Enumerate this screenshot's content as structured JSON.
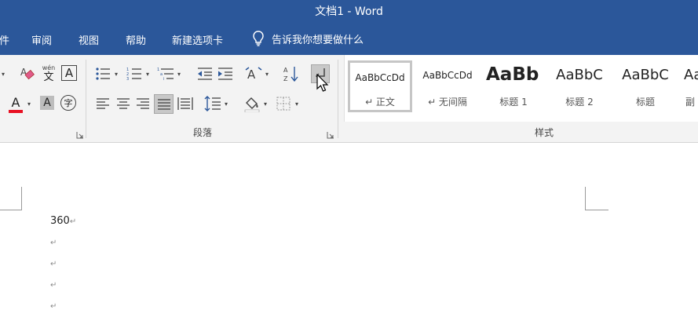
{
  "window": {
    "title": "文档1  -  Word"
  },
  "tabs": [
    "件",
    "审阅",
    "视图",
    "帮助",
    "新建选项卡"
  ],
  "tell_me": "告诉我你想要做什么",
  "ribbon": {
    "paragraph_group": "段落",
    "styles_group": "样式",
    "phonetic_glyph_top": "wén",
    "phonetic_glyph_main": "文",
    "boxed_char": "A",
    "shaded_char": "A",
    "font_color_char": "A",
    "enclosed_char": "字",
    "styles": [
      {
        "sample": "AaBbCcDd",
        "name": "↵ 正文",
        "selected": true
      },
      {
        "sample": "AaBbCcDd",
        "name": "↵ 无间隔"
      },
      {
        "sample": "AaBb",
        "name": "标题 1"
      },
      {
        "sample": "AaBbC",
        "name": "标题 2"
      },
      {
        "sample": "AaBbC",
        "name": "标题"
      },
      {
        "sample": "Aa",
        "name": "副"
      }
    ]
  },
  "document": {
    "paragraphs": [
      "360",
      "",
      "",
      "",
      ""
    ],
    "paragraph_mark": "↵"
  },
  "colors": {
    "accent": "#2b579a",
    "ribbon_bg": "#f3f3f3",
    "font_color_bar": "#e81123"
  }
}
